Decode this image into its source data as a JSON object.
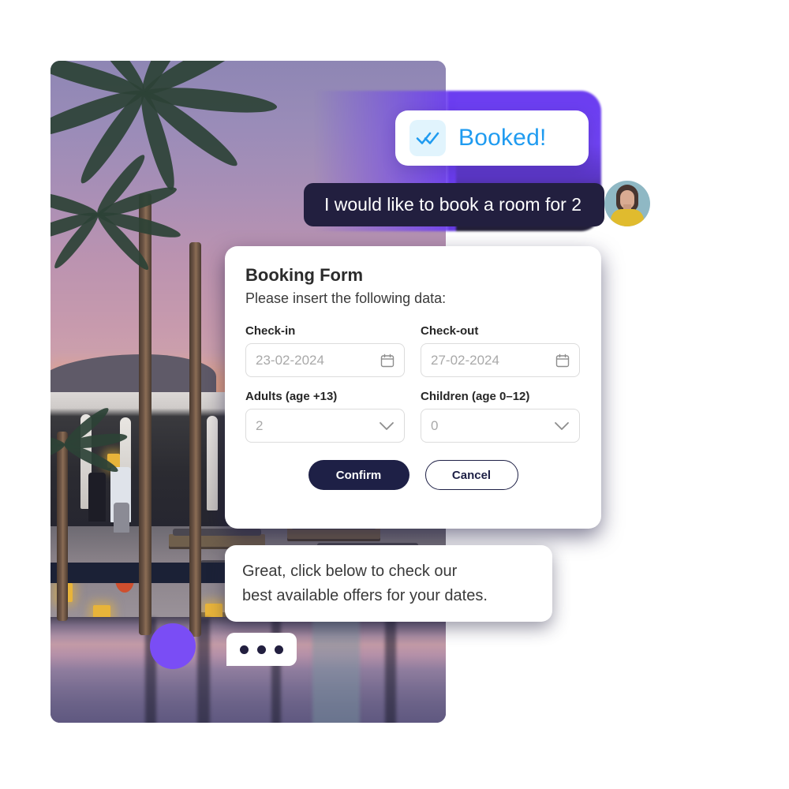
{
  "scene": {
    "background_photo": {
      "name": "resort-pool-sunset-photo",
      "description": "Palm trees at sunset beside a resort pool"
    },
    "accent_violet": "#7a4df5",
    "glow_purple": "#6b3df0",
    "dark_navy": "#221f3f"
  },
  "status_bubble": {
    "icon": "double-check-icon",
    "label": "Booked!",
    "label_color": "#1f9bf0",
    "icon_bg": "#e1f4fd"
  },
  "user_message": {
    "text": "I would like to book a room for 2",
    "bubble_color": "#221f3f",
    "avatar": "user-avatar"
  },
  "booking_form": {
    "title": "Booking Form",
    "subtitle": "Please insert the following data:",
    "fields": [
      {
        "label": "Check-in",
        "value": "23-02-2024",
        "icon": "calendar-icon",
        "type": "date"
      },
      {
        "label": "Check-out",
        "value": "27-02-2024",
        "icon": "calendar-icon",
        "type": "date"
      },
      {
        "label": "Adults (age +13)",
        "value": "2",
        "icon": "chevron-down-icon",
        "type": "select"
      },
      {
        "label": "Children (age 0–12)",
        "value": "0",
        "icon": "chevron-down-icon",
        "type": "select"
      }
    ],
    "confirm_label": "Confirm",
    "cancel_label": "Cancel"
  },
  "bot_message": {
    "line1": "Great, click below to check our",
    "line2": "best available offers for your dates."
  },
  "typing_indicator": {
    "name": "typing-indicator",
    "dots": 3
  }
}
